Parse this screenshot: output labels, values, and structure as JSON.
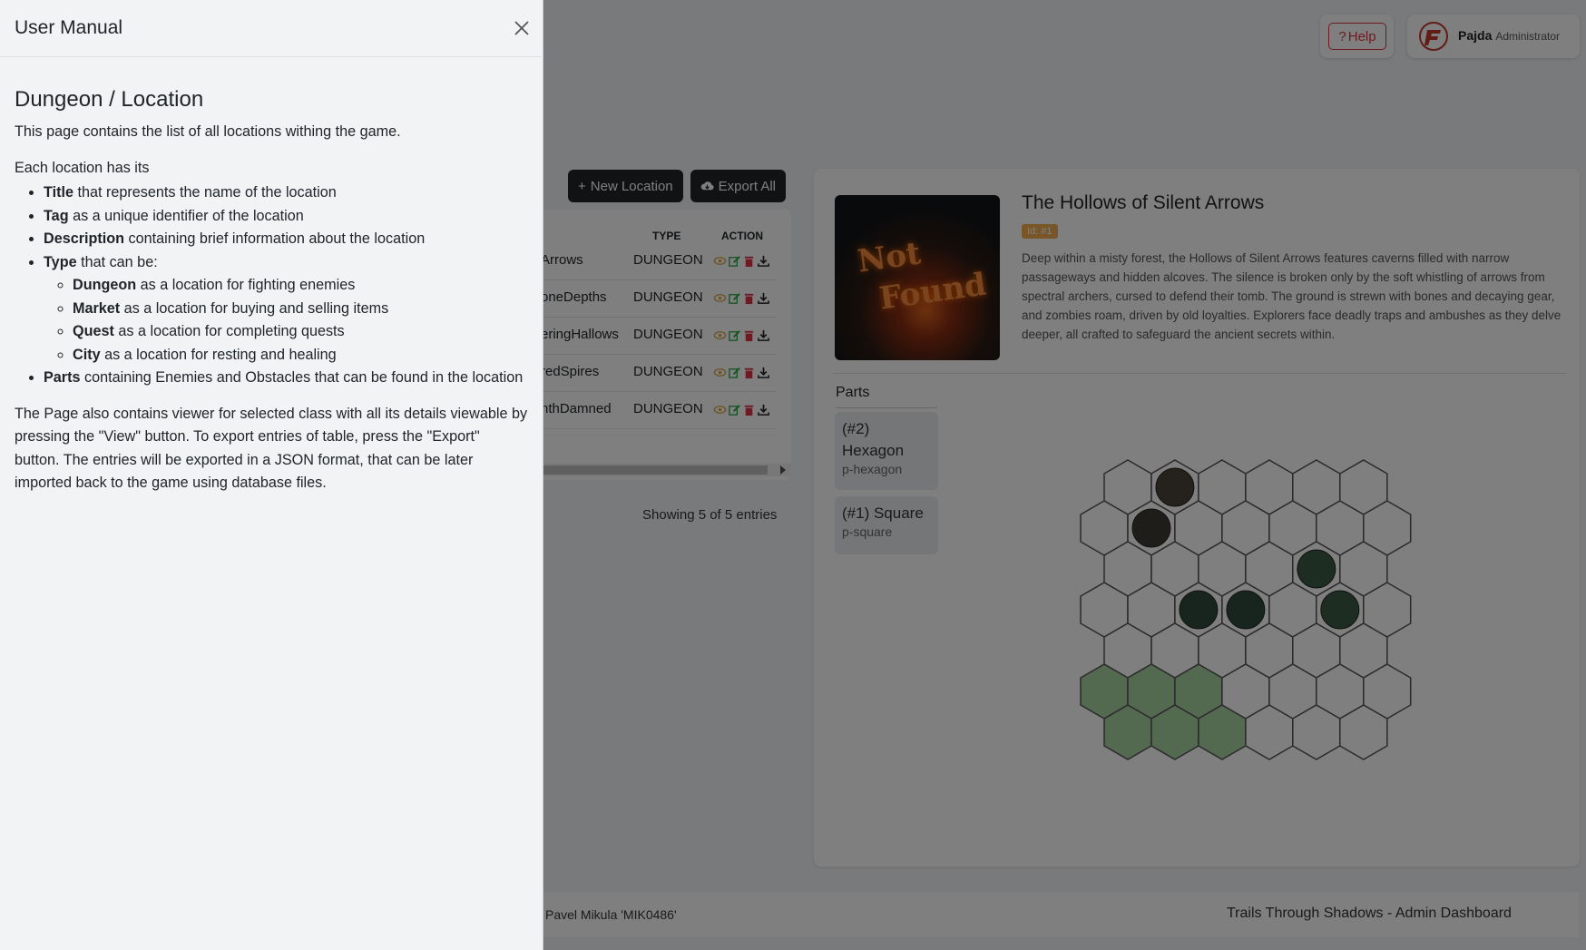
{
  "header": {
    "help_label": "Help",
    "help_icon": "?",
    "user_name": "Pajda",
    "user_role": "Administrator"
  },
  "toolbar": {
    "new_location_label": "New Location",
    "export_all_label": "Export All"
  },
  "table": {
    "columns": [
      "TYPE",
      "ACTION"
    ],
    "rows": [
      {
        "name": "Arrows",
        "type": "DUNGEON"
      },
      {
        "name": "oneDepths",
        "type": "DUNGEON"
      },
      {
        "name": "eringHallows",
        "type": "DUNGEON"
      },
      {
        "name": "redSpires",
        "type": "DUNGEON"
      },
      {
        "name": "nthDamned",
        "type": "DUNGEON"
      }
    ],
    "entries_text": "Showing 5 of 5 entries"
  },
  "detail": {
    "image_text_line1": "Not",
    "image_text_line2": "Found",
    "title": "The Hollows of Silent Arrows",
    "badge": "Id: #1",
    "description": "Deep within a misty forest, the Hollows of Silent Arrows features caverns filled with narrow passageways and hidden alcoves. The silence is broken only by the soft whistling of arrows from spectral archers, cursed to defend their tomb. The ground is strewn with bones and decaying gear, and zombies roam, driven by old loyalties. Explorers face deadly traps and ambushes as they delve deeper, all crafted to safeguard the ancient secrets within.",
    "parts_label": "Parts",
    "parts": [
      {
        "title": "(#2) Hexagon",
        "slug": "p-hexagon"
      },
      {
        "title": "(#1) Square",
        "slug": "p-square"
      }
    ]
  },
  "footer": {
    "author": "Pavel Mikula 'MIK0486'",
    "app_name": "Trails Through Shadows - Admin Dashboard"
  },
  "manual": {
    "title": "User Manual",
    "heading": "Dungeon / Location",
    "intro": "This page contains the list of all locations withing the game.",
    "subheading": "Each location has its",
    "items": [
      {
        "term": "Title",
        "text": " that represents the name of the location"
      },
      {
        "term": "Tag",
        "text": " as a unique identifier of the location"
      },
      {
        "term": "Description",
        "text": " containing brief information about the location"
      },
      {
        "term": "Type",
        "text": " that can be:"
      },
      {
        "term": "Parts",
        "text": " containing Enemies and Obstacles that can be found in the location"
      }
    ],
    "types": [
      {
        "term": "Dungeon",
        "text": " as a location for fighting enemies"
      },
      {
        "term": "Market",
        "text": " as a location for buying and selling items"
      },
      {
        "term": "Quest",
        "text": " as a location for completing quests"
      },
      {
        "term": "City",
        "text": " as a location for resting and healing"
      }
    ],
    "outro": "The Page also contains viewer for selected class with all its details viewable by pressing the \"View\" button. To export entries of table, press the \"Export\" button. The entries will be exported in a JSON format, that can be later imported back to the game using database files."
  },
  "colors": {
    "overlay": "rgba(0,0,0,0.5)",
    "danger": "#dc3545",
    "badge": "#f0ad4e",
    "hex_highlight": "#a8d5a0"
  }
}
